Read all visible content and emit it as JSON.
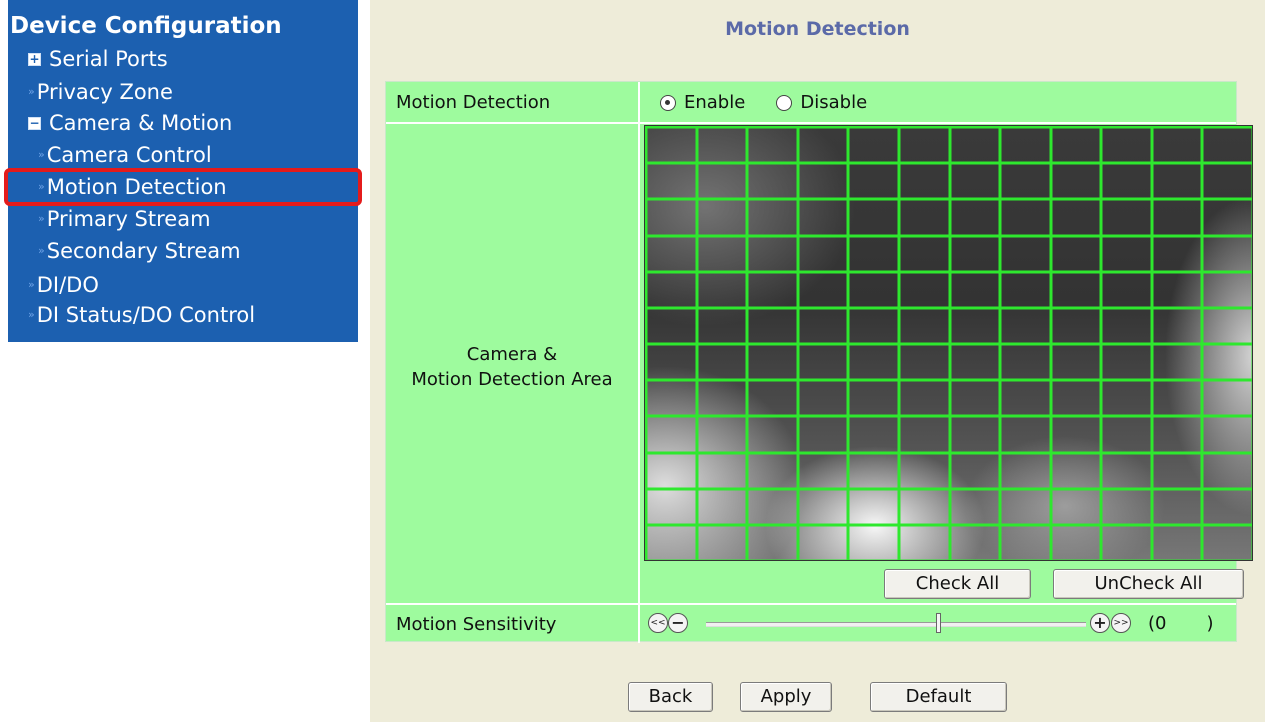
{
  "sidebar": {
    "title": "Device Configuration",
    "items": [
      {
        "label": "Serial Ports",
        "expander": "+"
      },
      {
        "label": "Privacy Zone",
        "bullet": "»"
      },
      {
        "label": "Camera & Motion",
        "expander": "−"
      },
      {
        "label": "Camera Control",
        "bullet": "»"
      },
      {
        "label": "Motion Detection",
        "bullet": "»"
      },
      {
        "label": "Primary Stream",
        "bullet": "»"
      },
      {
        "label": "Secondary Stream",
        "bullet": "»"
      },
      {
        "label": "DI/DO",
        "bullet": "»"
      },
      {
        "label": "DI Status/DO Control",
        "bullet": "»"
      }
    ],
    "selected": "Motion Detection"
  },
  "main": {
    "title": "Motion Detection",
    "motion_detection": {
      "label": "Motion Detection",
      "enable_label": "Enable",
      "disable_label": "Disable",
      "selected": "Enable"
    },
    "area": {
      "label_line1": "Camera &",
      "label_line2": "Motion Detection Area",
      "grid_rows": 12,
      "grid_cols": 12,
      "check_all_label": "Check All",
      "uncheck_all_label": "UnCheck All"
    },
    "sensitivity": {
      "label": "Motion Sensitivity",
      "fast_decrease": "<<",
      "decrease": "−",
      "increase": "+",
      "fast_increase": ">>",
      "readout": "(0       )",
      "level_fraction": 0.61
    },
    "buttons": {
      "back": "Back",
      "apply": "Apply",
      "default": "Default"
    }
  },
  "colors": {
    "sidebar_bg": "#1c60b0",
    "panel_bg": "#eeecd9",
    "table_bg": "#9efb9e",
    "grid_line": "#2ee82e",
    "title_color": "#5b6aa8",
    "highlight": "#e41b1b"
  },
  "icons": [
    "expand-plus-icon",
    "collapse-minus-icon",
    "bullet-arrow-icon",
    "radio-icon"
  ]
}
